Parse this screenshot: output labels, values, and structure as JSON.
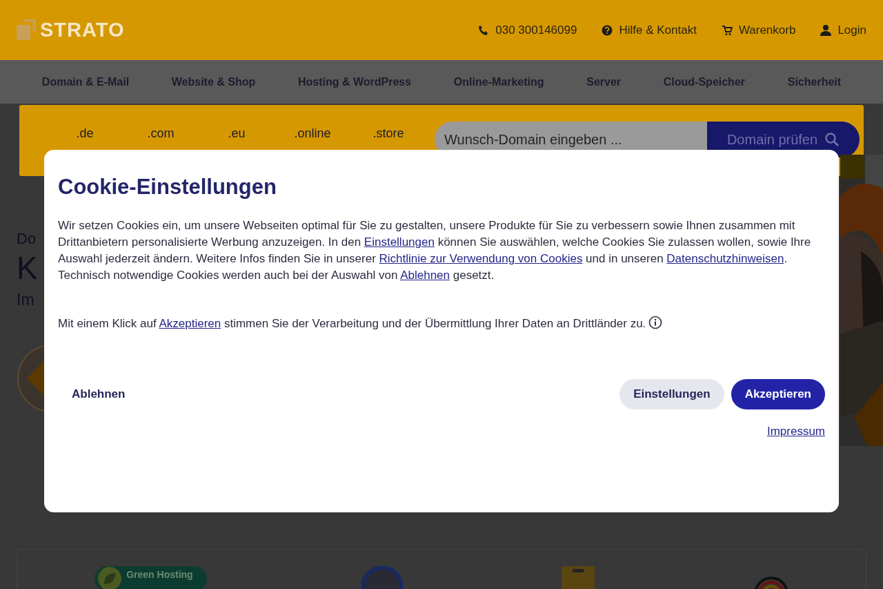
{
  "header": {
    "logo": "STRATO",
    "links": [
      {
        "kind": "phone",
        "text": "030 300146099"
      },
      {
        "kind": "help",
        "text": "Hilfe & Kontakt"
      },
      {
        "kind": "cart",
        "text": "Warenkorb"
      },
      {
        "kind": "user",
        "text": "Login"
      }
    ]
  },
  "nav": {
    "items": [
      "Domain & E-Mail",
      "Website & Shop",
      "Hosting & WordPress",
      "Online-Marketing",
      "Server",
      "Cloud-Speicher",
      "Sicherheit"
    ]
  },
  "domain_bar": {
    "tlds": [
      ".de",
      ".com",
      ".eu",
      ".online",
      ".store"
    ],
    "search": {
      "placeholder": "Wunsch-Domain eingeben ..."
    },
    "button": "Domain prüfen"
  },
  "hero": {
    "eyebrow": "Do",
    "headline": "K",
    "subline": "Im",
    "kind": "picture"
  },
  "badges": [
    {
      "kind": "green",
      "text": "Green Hosting"
    },
    {
      "kind": "tuv"
    },
    {
      "kind": "welt"
    },
    {
      "kind": "hosted"
    }
  ],
  "cookie_dialog": {
    "title": "Cookie-Einstellungen",
    "paragraphs": [
      {
        "segments": [
          {
            "kind": "text",
            "text": "Wir setzen Cookies ein, um unsere Webseiten optimal für Sie zu gestalten, unsere Produkte für Sie zu verbessern sowie Ihnen zusammen mit Drittanbietern personalisierte Werbung anzuzeigen. In den "
          },
          {
            "kind": "link",
            "text": "Einstellungen"
          },
          {
            "kind": "text",
            "text": " können Sie auswählen, welche Cookies Sie zulassen wollen, sowie Ihre Auswahl jederzeit ändern. Weitere Infos finden Sie in unserer "
          },
          {
            "kind": "link",
            "text": "Richtlinie zur Verwendung von Cookies"
          },
          {
            "kind": "text",
            "text": " und in unseren "
          },
          {
            "kind": "link",
            "text": "Datenschutzhinweisen"
          },
          {
            "kind": "text",
            "text": ". Technisch notwendige Cookies werden auch bei der Auswahl von "
          },
          {
            "kind": "link",
            "text": "Ablehnen"
          },
          {
            "kind": "text",
            "text": " gesetzt."
          }
        ]
      },
      {
        "segments": [
          {
            "kind": "text",
            "text": "Mit einem Klick auf "
          },
          {
            "kind": "link",
            "text": "Akzeptieren"
          },
          {
            "kind": "text",
            "text": " stimmen Sie der Verarbeitung und der Übermittlung Ihrer Daten an Drittländer zu."
          },
          {
            "kind": "info_icon"
          }
        ]
      }
    ],
    "buttons": [
      {
        "kind": "plain",
        "label": "Ablehnen"
      },
      {
        "kind": "secondary",
        "label": "Einstellungen"
      },
      {
        "kind": "primary",
        "label": "Akzeptieren"
      }
    ],
    "footer_link": "Impressum"
  }
}
